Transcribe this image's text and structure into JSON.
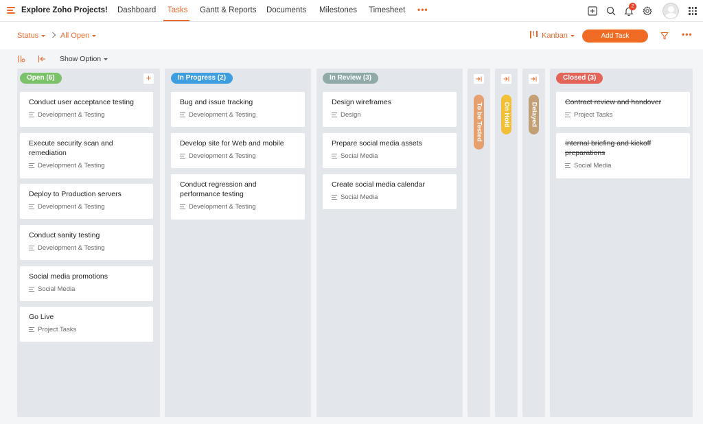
{
  "app": {
    "title": "Explore Zoho Projects!"
  },
  "nav": {
    "tabs": [
      {
        "label": "Dashboard"
      },
      {
        "label": "Tasks"
      },
      {
        "label": "Gantt & Reports"
      },
      {
        "label": "Documents"
      },
      {
        "label": "Milestones"
      },
      {
        "label": "Timesheet"
      }
    ],
    "active_tab": "Tasks",
    "more": "•••",
    "notification_count": "2"
  },
  "subbar": {
    "status_filter": "Status",
    "view_filter": "All Open",
    "view_mode": "Kanban",
    "add_task": "Add Task",
    "more": "•••"
  },
  "toolbar": {
    "show_option": "Show Option"
  },
  "colors": {
    "accent": "#f06c25",
    "open": "#7cc26a",
    "in_progress": "#3e9fe0",
    "in_review": "#8faaa9",
    "to_be_tested": "#e6a06d",
    "on_hold": "#f2c037",
    "delayed": "#c29f75",
    "closed": "#e5645a"
  },
  "columns": [
    {
      "label": "Open (6)",
      "cards": [
        {
          "title": [
            "Conduct user acceptance testing"
          ],
          "list": "Development & Testing"
        },
        {
          "title": [
            "Execute security scan and",
            "remediation"
          ],
          "list": "Development & Testing"
        },
        {
          "title": [
            "Deploy to Production servers"
          ],
          "list": "Development & Testing"
        },
        {
          "title": [
            "Conduct sanity testing"
          ],
          "list": "Development & Testing"
        },
        {
          "title": [
            "Social media promotions"
          ],
          "list": "Social Media"
        },
        {
          "title": [
            "Go Live"
          ],
          "list": "Project Tasks"
        }
      ]
    },
    {
      "label": "In Progress (2)",
      "cards": [
        {
          "title": [
            "Bug and issue tracking"
          ],
          "list": "Development & Testing"
        },
        {
          "title": [
            "Develop site for Web and mobile"
          ],
          "list": "Development & Testing"
        },
        {
          "title": [
            "Conduct regression and",
            "performance testing"
          ],
          "list": "Development & Testing"
        }
      ]
    },
    {
      "label": "In Review (3)",
      "cards": [
        {
          "title": [
            "Design wireframes"
          ],
          "list": "Design"
        },
        {
          "title": [
            "Prepare social media assets"
          ],
          "list": "Social Media"
        },
        {
          "title": [
            "Create social media calendar"
          ],
          "list": "Social Media"
        }
      ]
    },
    {
      "label": "Closed (3)",
      "cards": [
        {
          "title": [
            "Contract review and handover"
          ],
          "list": "Project Tasks"
        },
        {
          "title": [
            "Internal briefing and kickoff",
            "preparations"
          ],
          "list": "Social Media"
        }
      ]
    }
  ],
  "collapsed_columns": [
    {
      "label": "To be Tested"
    },
    {
      "label": "On Hold"
    },
    {
      "label": "Delayed"
    }
  ]
}
